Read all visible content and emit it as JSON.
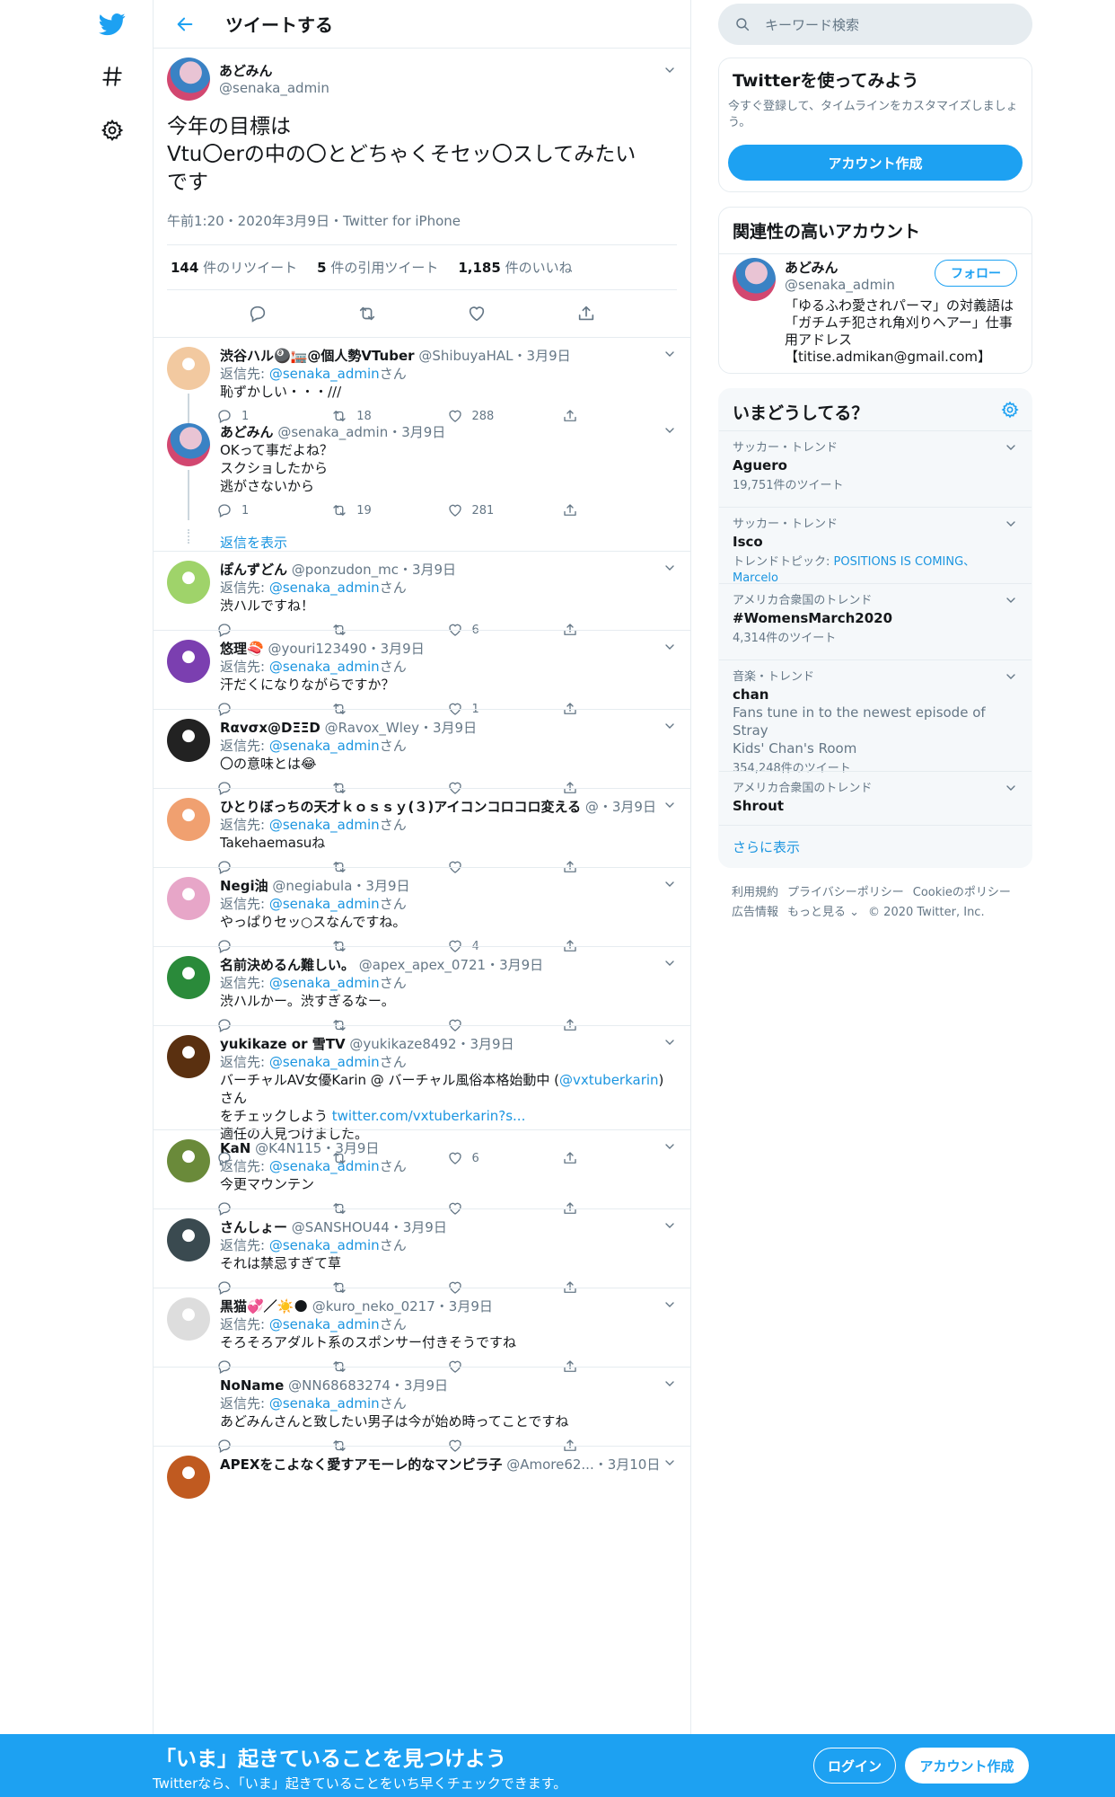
{
  "colors": {
    "accent": "#1da1f2",
    "text": "#14171a",
    "muted": "#657786",
    "border": "#e6ecf0",
    "like": "#e0245e"
  },
  "nav": {
    "icons": [
      "twitter-bird-icon",
      "hashtag-icon",
      "gear-icon"
    ]
  },
  "header": {
    "title": "ツイートする"
  },
  "main_tweet": {
    "name": "あどみん",
    "handle": "@senaka_admin",
    "text_line1": "今年の目標は",
    "text_line2": "Vtu〇erの中の〇とどちゃくそセッ〇スしてみたい",
    "text_line3": "です",
    "meta": "午前1:20・2020年3月9日・Twitter for iPhone",
    "retweets": "144",
    "retweets_label": "件のリツイート",
    "quotes": "5",
    "quotes_label": "件の引用ツイート",
    "likes": "1,185",
    "likes_label": "件のいいね"
  },
  "reply_prefix": "返信先: ",
  "reply_suffix": "さん",
  "reply_to": "@senaka_admin",
  "show_replies": "返信を表示",
  "replies": [
    {
      "name": "渋谷ハル🎱🏣@個人勢VTuber",
      "handle": "@ShibuyaHAL",
      "date": "・3月9日",
      "body": "恥ずかしい・・・///",
      "reply": "1",
      "rt": "18",
      "like": "288"
    },
    {
      "name": "あどみん",
      "handle": "@senaka_admin",
      "date": "・3月9日",
      "body1": "OKって事だよね？",
      "body2": "スクショしたから",
      "body3": "逃がさないから",
      "reply": "1",
      "rt": "19",
      "like": "281"
    },
    {
      "name": "ぽんずどん",
      "handle": "@ponzudon_mc",
      "date": "・3月9日",
      "body": "渋ハルですね！",
      "reply": "",
      "rt": "",
      "like": "6"
    },
    {
      "name": "悠理🍣",
      "handle": "@youri123490",
      "date": "・3月9日",
      "body": "汗だくになりながらですか？",
      "reply": "",
      "rt": "",
      "like": "1"
    },
    {
      "name": "Rαvσx@DΞΞD",
      "handle": "@Ravox_Wley",
      "date": "・3月9日",
      "body": "〇の意味とは😂",
      "reply": "",
      "rt": "",
      "like": ""
    },
    {
      "name": "ひとりぼっちの天才ｋｏｓｓｙ(３)アイコンコロコロ変える",
      "handle": "@",
      "date": "・3月9日",
      "body": "Takehaemasuね",
      "reply": "",
      "rt": "",
      "like": ""
    },
    {
      "name": "Negi油",
      "handle": "@negiabula",
      "date": "・3月9日",
      "body": "やっぱりセッ○スなんですね。",
      "reply": "",
      "rt": "",
      "like": "4"
    },
    {
      "name": "名前決めるん難しい。",
      "handle": "@apex_apex_0721",
      "date": "・3月9日",
      "body": "渋ハルかー。渋すぎるなー。",
      "reply": "",
      "rt": "",
      "like": ""
    },
    {
      "name": "yukikaze or 雪TV",
      "handle": "@yukikaze8492",
      "date": "・3月9日",
      "body1a": "バーチャルAV女優Karin @ バーチャル風俗本格始動中 (",
      "body1link": "@vxtuberkarin",
      "body1b": ")さん",
      "body2a": "をチェックしよう ",
      "body2link": "twitter.com/vxtuberkarin?s...",
      "body3": "適任の人見つけました。",
      "reply": "",
      "rt": "",
      "like": "6"
    },
    {
      "name": "KaN",
      "handle": "@K4N115",
      "date": "・3月9日",
      "body": "今更マウンテン",
      "reply": "",
      "rt": "",
      "like": ""
    },
    {
      "name": "さんしょー",
      "handle": "@SANSHOU44",
      "date": "・3月9日",
      "body": "それは禁忌すぎて草",
      "reply": "",
      "rt": "",
      "like": ""
    },
    {
      "name": "黒猫💞／☀️🌑",
      "handle": "@kuro_neko_0217",
      "date": "・3月9日",
      "body": "そろそろアダルト系のスポンサー付きそうですね",
      "reply": "",
      "rt": "",
      "like": ""
    },
    {
      "name": "NoName",
      "handle": "@NN68683274",
      "date": "・3月9日",
      "body": "あどみんさんと致したい男子は今が始め時ってことですね",
      "reply": "",
      "rt": "",
      "like": ""
    },
    {
      "name": "APEXをこよなく愛すアモーレ的なマンピラ子",
      "handle": "@Amore62...",
      "date": "・3月10日"
    }
  ],
  "right": {
    "search_placeholder": "キーワード検索",
    "signup_card": {
      "title": "Twitterを使ってみよう",
      "desc": "今すぐ登録して、タイムラインをカスタマイズしましょう。",
      "button": "アカウント作成"
    },
    "related": {
      "title": "関連性の高いアカウント",
      "name": "あどみん",
      "handle": "@senaka_admin",
      "follow": "フォロー",
      "bio1": "「ゆるふわ愛されパーマ」の対義語は",
      "bio2": "「ガチムチ犯され角刈りヘアー」仕事",
      "bio3": "用アドレス",
      "bio4": "【titise.admikan@gmail.com】"
    },
    "trends": {
      "title": "いまどうしてる？",
      "items": [
        {
          "ctx": "サッカー・トレンド",
          "name": "Aguero",
          "sub": "19,751件のツイート"
        },
        {
          "ctx": "サッカー・トレンド",
          "name": "Isco",
          "sub_prefix": "トレンドトピック: ",
          "sub_links": "POSITIONS IS COMING、Marcelo"
        },
        {
          "ctx": "アメリカ合衆国のトレンド",
          "name": "#WomensMarch2020",
          "sub": "4,314件のツイート"
        },
        {
          "ctx": "音楽・トレンド",
          "name": "chan",
          "desc1": "Fans tune in to the newest episode of Stray",
          "desc2": "Kids' Chan's Room",
          "sub": "354,248件のツイート"
        },
        {
          "ctx": "アメリカ合衆国のトレンド",
          "name": "Shrout"
        }
      ],
      "more": "さらに表示"
    },
    "footer": {
      "l1": [
        "利用規約",
        "プライバシーポリシー",
        "Cookieのポリシー"
      ],
      "l2": [
        "広告情報",
        "もっと見る ⌄",
        "© 2020 Twitter, Inc."
      ]
    }
  },
  "bottom_bar": {
    "title": "「いま」起きていることを見つけよう",
    "subtitle": "Twitterなら、「いま」起きていることをいち早くチェックできます。",
    "login": "ログイン",
    "signup": "アカウント作成"
  }
}
